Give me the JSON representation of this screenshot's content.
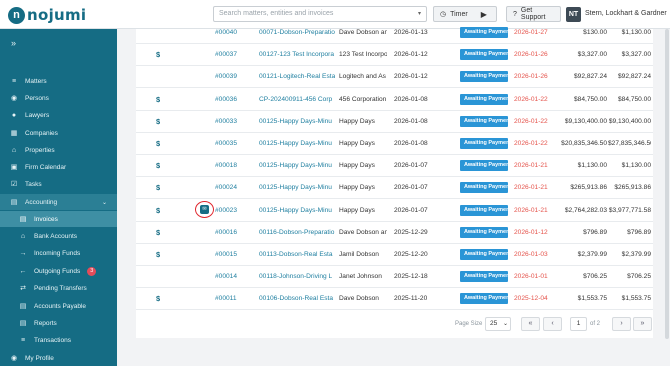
{
  "app": {
    "logo_mark": "n",
    "logo_text": "nojumi"
  },
  "search": {
    "placeholder": "Search matters, entities and invoices",
    "chevron": "▾"
  },
  "header": {
    "timer_label": "Timer",
    "support_label": "Get Support",
    "avatar_initials": "NT",
    "firm_name": "Stern, Lockhart & Gardner"
  },
  "sidebar": {
    "collapse_icon": "»",
    "items": [
      {
        "label": "Matters",
        "icon": "layers-icon",
        "glyph": "≡"
      },
      {
        "label": "Persons",
        "icon": "people-icon",
        "glyph": "◉"
      },
      {
        "label": "Lawyers",
        "icon": "user-icon",
        "glyph": "●"
      },
      {
        "label": "Companies",
        "icon": "building-icon",
        "glyph": "▦"
      },
      {
        "label": "Properties",
        "icon": "home-icon",
        "glyph": "⌂"
      },
      {
        "label": "Firm Calendar",
        "icon": "calendar-icon",
        "glyph": "▣"
      },
      {
        "label": "Tasks",
        "icon": "checkbox-icon",
        "glyph": "☑"
      },
      {
        "label": "Accounting",
        "icon": "ledger-icon",
        "glyph": "▤",
        "caret": "⌄"
      }
    ],
    "sub_items": [
      {
        "label": "Invoices",
        "icon": "invoice-icon",
        "glyph": "▤"
      },
      {
        "label": "Bank Accounts",
        "icon": "bank-icon",
        "glyph": "⌂"
      },
      {
        "label": "Incoming Funds",
        "icon": "arrow-in-icon",
        "glyph": "→"
      },
      {
        "label": "Outgoing Funds",
        "icon": "arrow-out-icon",
        "glyph": "←",
        "badge": "3"
      },
      {
        "label": "Pending Transfers",
        "icon": "transfer-icon",
        "glyph": "⇄"
      },
      {
        "label": "Accounts Payable",
        "icon": "payable-icon",
        "glyph": "▤"
      },
      {
        "label": "Reports",
        "icon": "report-icon",
        "glyph": "▤"
      },
      {
        "label": "Transactions",
        "icon": "list-icon",
        "glyph": "≡"
      }
    ],
    "profile": {
      "label": "My Profile",
      "icon": "profile-icon",
      "glyph": "◉"
    }
  },
  "invoices": {
    "rows": [
      {
        "dollar": "",
        "number": "#00040",
        "matter": "00071-Dobson-Preparatio",
        "client": "Dave Dobson an",
        "date": "2026-01-13",
        "status": "Awaiting Payment",
        "due": "2026-01-27",
        "total": "$130.00",
        "balance": "$1,130.00"
      },
      {
        "dollar": "$",
        "number": "#00037",
        "matter": "00127-123 Test Incorpora",
        "client": "123 Test Incorpo",
        "date": "2026-01-12",
        "status": "Awaiting Payment",
        "due": "2026-01-26",
        "total": "$3,327.00",
        "balance": "$3,327.00"
      },
      {
        "dollar": "",
        "number": "#00039",
        "matter": "00121-Logitech-Real Esta",
        "client": "Logitech and As",
        "date": "2026-01-12",
        "status": "Awaiting Payment",
        "due": "2026-01-26",
        "total": "$92,827.24",
        "balance": "$92,827.24"
      },
      {
        "dollar": "$",
        "number": "#00036",
        "matter": "CP-202400911-456 Corp",
        "client": "456 Corporation",
        "date": "2026-01-08",
        "status": "Awaiting Payment",
        "due": "2026-01-22",
        "total": "$84,750.00",
        "balance": "$84,750.00"
      },
      {
        "dollar": "$",
        "number": "#00033",
        "matter": "00125-Happy Days-Minu",
        "client": "Happy Days",
        "date": "2026-01-08",
        "status": "Awaiting Payment",
        "due": "2026-01-22",
        "total": "$9,130,400.00",
        "balance": "$9,130,400.00"
      },
      {
        "dollar": "$",
        "number": "#00035",
        "matter": "00125-Happy Days-Minu",
        "client": "Happy Days",
        "date": "2026-01-08",
        "status": "Awaiting Payment",
        "due": "2026-01-22",
        "total": "$20,835,346.50",
        "balance": "$27,835,346.50"
      },
      {
        "dollar": "$",
        "number": "#00018",
        "matter": "00125-Happy Days-Minu",
        "client": "Happy Days",
        "date": "2026-01-07",
        "status": "Awaiting Payment",
        "due": "2026-01-21",
        "total": "$1,130.00",
        "balance": "$1,130.00"
      },
      {
        "dollar": "$",
        "number": "#00024",
        "matter": "00125-Happy Days-Minu",
        "client": "Happy Days",
        "date": "2026-01-07",
        "status": "Awaiting Payment",
        "due": "2026-01-21",
        "total": "$265,913.86",
        "balance": "$265,913.86"
      },
      {
        "dollar": "$",
        "number": "#00023",
        "matter": "00125-Happy Days-Minu",
        "client": "Happy Days",
        "date": "2026-01-07",
        "status": "Awaiting Payment",
        "due": "2026-01-21",
        "total": "$2,764,282.03",
        "balance": "$3,977,771.58",
        "mail": true
      },
      {
        "dollar": "$",
        "number": "#00016",
        "matter": "00116-Dobson-Preparatio",
        "client": "Dave Dobson an",
        "date": "2025-12-29",
        "status": "Awaiting Payment",
        "due": "2026-01-12",
        "total": "$796.89",
        "balance": "$796.89"
      },
      {
        "dollar": "$",
        "number": "#00015",
        "matter": "00113-Dobson-Real Esta",
        "client": "Jamil Dobson",
        "date": "2025-12-20",
        "status": "Awaiting Payment",
        "due": "2026-01-03",
        "total": "$2,379.99",
        "balance": "$2,379.99"
      },
      {
        "dollar": "",
        "number": "#00014",
        "matter": "00118-Johnson-Driving L",
        "client": "Janet Johnson",
        "date": "2025-12-18",
        "status": "Awaiting Payment",
        "due": "2026-01-01",
        "total": "$706.25",
        "balance": "$706.25"
      },
      {
        "dollar": "$",
        "number": "#00011",
        "matter": "00106-Dobson-Real Esta",
        "client": "Dave Dobson",
        "date": "2025-11-20",
        "status": "Awaiting Payment",
        "due": "2025-12-04",
        "total": "$1,553.75",
        "balance": "$1,553.75"
      }
    ]
  },
  "pagination": {
    "page_size_label": "Page Size",
    "page_size": "25",
    "page_size_caret": "⌄",
    "first": "«",
    "prev": "‹",
    "current": "1",
    "of_label": "of 2",
    "next": "›",
    "last": "»"
  },
  "colors": {
    "brand": "#156c84",
    "status": "#2a95d6",
    "overdue": "#e5534b",
    "highlight_ring": "#e0262d"
  }
}
